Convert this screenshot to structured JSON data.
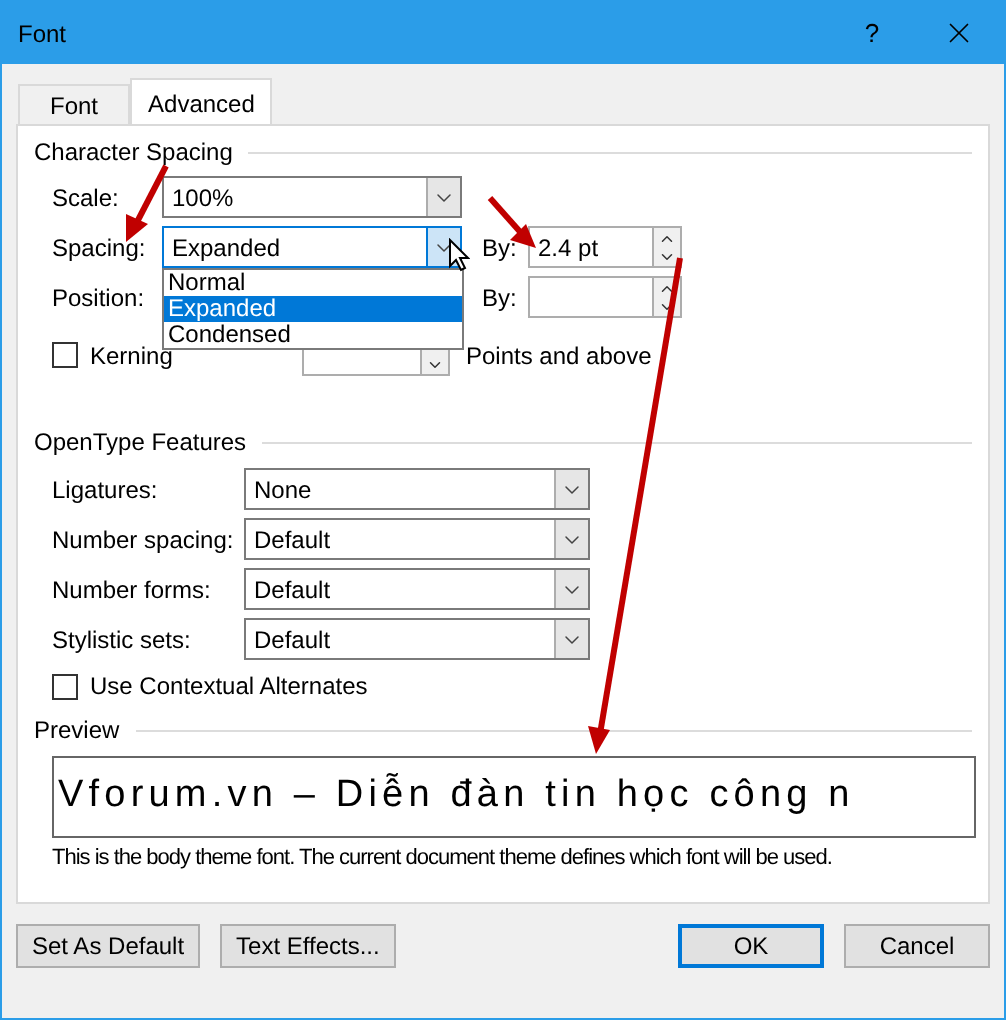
{
  "window": {
    "title": "Font",
    "help": "?"
  },
  "tabs": [
    {
      "label": "Font",
      "selected": false
    },
    {
      "label": "Advanced",
      "selected": true
    }
  ],
  "character_spacing": {
    "title": "Character Spacing",
    "scale": {
      "label": "Scale:",
      "value": "100%"
    },
    "spacing": {
      "label": "Spacing:",
      "value": "Expanded",
      "expanded": true,
      "options": [
        {
          "label": "Normal",
          "selected": false
        },
        {
          "label": "Expanded",
          "selected": true
        },
        {
          "label": "Condensed",
          "selected": false
        }
      ]
    },
    "spacing_by": {
      "label": "By:",
      "value": "2.4 pt"
    },
    "position": {
      "label": "Position:"
    },
    "position_by": {
      "label": "By:"
    },
    "kerning": {
      "label": "Kerning",
      "checked": false,
      "suffix": "Points and above"
    }
  },
  "opentype": {
    "title": "OpenType Features",
    "rows": [
      {
        "label": "Ligatures:",
        "value": "None"
      },
      {
        "label": "Number spacing:",
        "value": "Default"
      },
      {
        "label": "Number forms:",
        "value": "Default"
      },
      {
        "label": "Stylistic sets:",
        "value": "Default"
      }
    ],
    "contextual": {
      "label": "Use Contextual Alternates",
      "checked": false
    }
  },
  "preview": {
    "title": "Preview",
    "sample": "Vforum.vn – Diễn đàn tin học công n",
    "note": "This is the body theme font. The current document theme defines which font will be used."
  },
  "footer": {
    "left": [
      {
        "label": "Set As Default",
        "focused": false
      },
      {
        "label": "Text Effects...",
        "focused": false
      }
    ],
    "right": [
      {
        "label": "OK",
        "focused": true
      },
      {
        "label": "Cancel",
        "focused": false
      }
    ]
  }
}
